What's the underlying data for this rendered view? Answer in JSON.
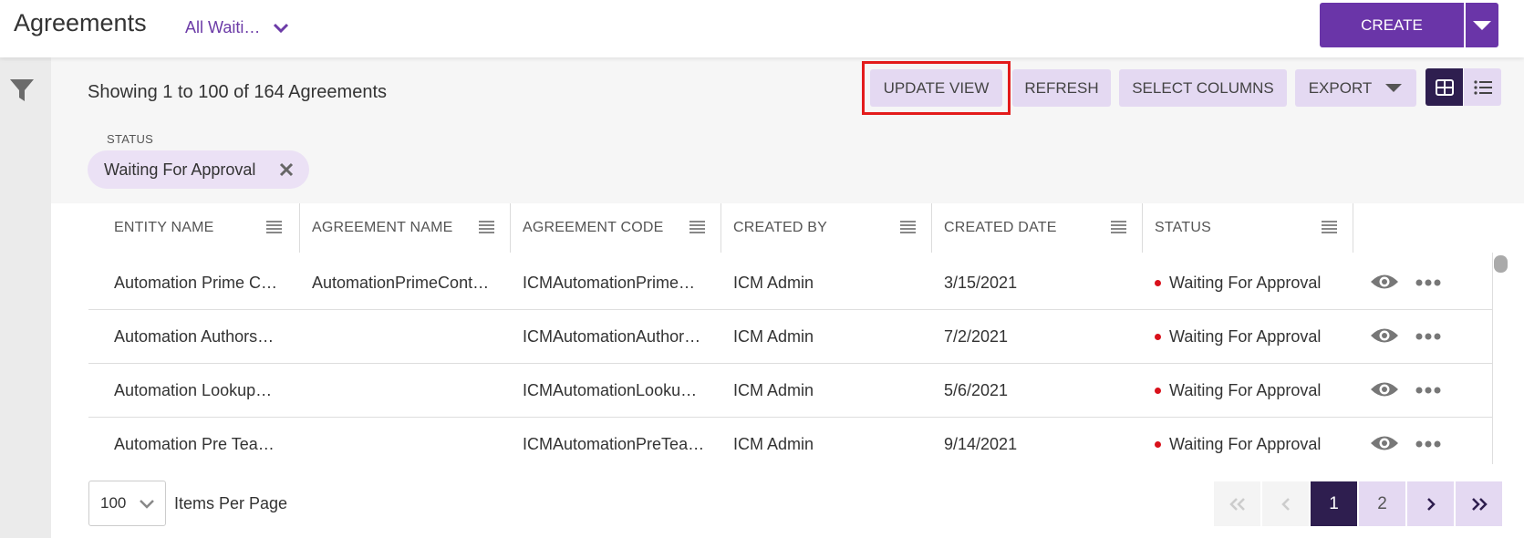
{
  "header": {
    "title": "Agreements",
    "view_selector": "All Waiti…",
    "create_label": "CREATE"
  },
  "toolbar": {
    "showing_text": "Showing 1 to 100 of 164 Agreements",
    "update_view": "UPDATE VIEW",
    "refresh": "REFRESH",
    "select_columns": "SELECT COLUMNS",
    "export": "EXPORT"
  },
  "filters": {
    "status_label": "STATUS",
    "status_chip": "Waiting For Approval"
  },
  "table": {
    "columns": [
      "ENTITY NAME",
      "AGREEMENT NAME",
      "AGREEMENT CODE",
      "CREATED BY",
      "CREATED DATE",
      "STATUS"
    ],
    "rows": [
      [
        "Automation Prime C…",
        "AutomationPrimeCont…",
        "ICMAutomationPrime…",
        "ICM Admin",
        "3/15/2021",
        "Waiting For Approval"
      ],
      [
        "Automation Authors…",
        "",
        "ICMAutomationAuthor…",
        "ICM Admin",
        "7/2/2021",
        "Waiting For Approval"
      ],
      [
        "Automation Lookup…",
        "",
        "ICMAutomationLooku…",
        "ICM Admin",
        "5/6/2021",
        "Waiting For Approval"
      ],
      [
        "Automation Pre Tea…",
        "",
        "ICMAutomationPreTea…",
        "ICM Admin",
        "9/14/2021",
        "Waiting For Approval"
      ]
    ]
  },
  "pagination": {
    "per_page_value": "100",
    "per_page_label": "Items Per Page",
    "pages": [
      "1",
      "2"
    ],
    "current_page": "1"
  },
  "colors": {
    "brand": "#6a35a8",
    "brand_dark": "#2e1e4f",
    "brand_light": "#e4d9f2",
    "status_dot": "#d9111b",
    "highlight": "#e31b1b"
  },
  "icons": {
    "filter": "filter-icon",
    "view": "eye-icon",
    "more": "more-horizontal-icon",
    "column_menu": "column-menu-icon",
    "grid_view": "grid-view-icon",
    "list_view": "list-view-icon"
  }
}
